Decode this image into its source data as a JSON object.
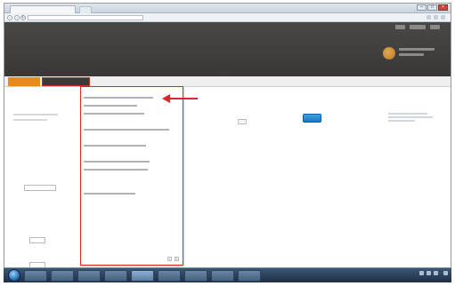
{
  "browser": {
    "tab_title": "",
    "url": "",
    "win_min": "–",
    "win_max": "□",
    "win_close": "×"
  },
  "app": {
    "logo": "",
    "top_nav": [
      "",
      "",
      "",
      ""
    ],
    "header_links": [
      "",
      "",
      ""
    ]
  },
  "nav_tabs": {
    "home": "",
    "selected": ""
  },
  "main": {
    "edit_link": "",
    "filters": [
      {
        "label": "",
        "value": ""
      },
      {
        "label": "",
        "value": ""
      },
      {
        "label": "",
        "value": ""
      },
      {
        "label": "",
        "value": ""
      }
    ],
    "field_label_1": "",
    "field_label_2": "",
    "input_value": "",
    "go_button": ""
  },
  "dropdown": {
    "items": [
      "",
      "",
      "",
      "",
      "",
      "",
      "",
      "",
      "",
      "",
      "",
      "",
      "",
      "",
      "",
      "",
      "",
      "",
      "",
      ""
    ],
    "pager_prev": "‹",
    "pager_next": "›"
  },
  "taskbar": {
    "clock": ""
  },
  "colors": {
    "accent_orange": "#e88a1e",
    "header_dark": "#3a3837",
    "highlight_red": "#d82828",
    "button_blue": "#1c77c5",
    "link_blue": "#3a7cc2"
  },
  "icons": [
    "back-icon",
    "forward-icon",
    "refresh-icon",
    "start-orb-icon",
    "red-arrow-icon",
    "user-avatar-icon"
  ]
}
